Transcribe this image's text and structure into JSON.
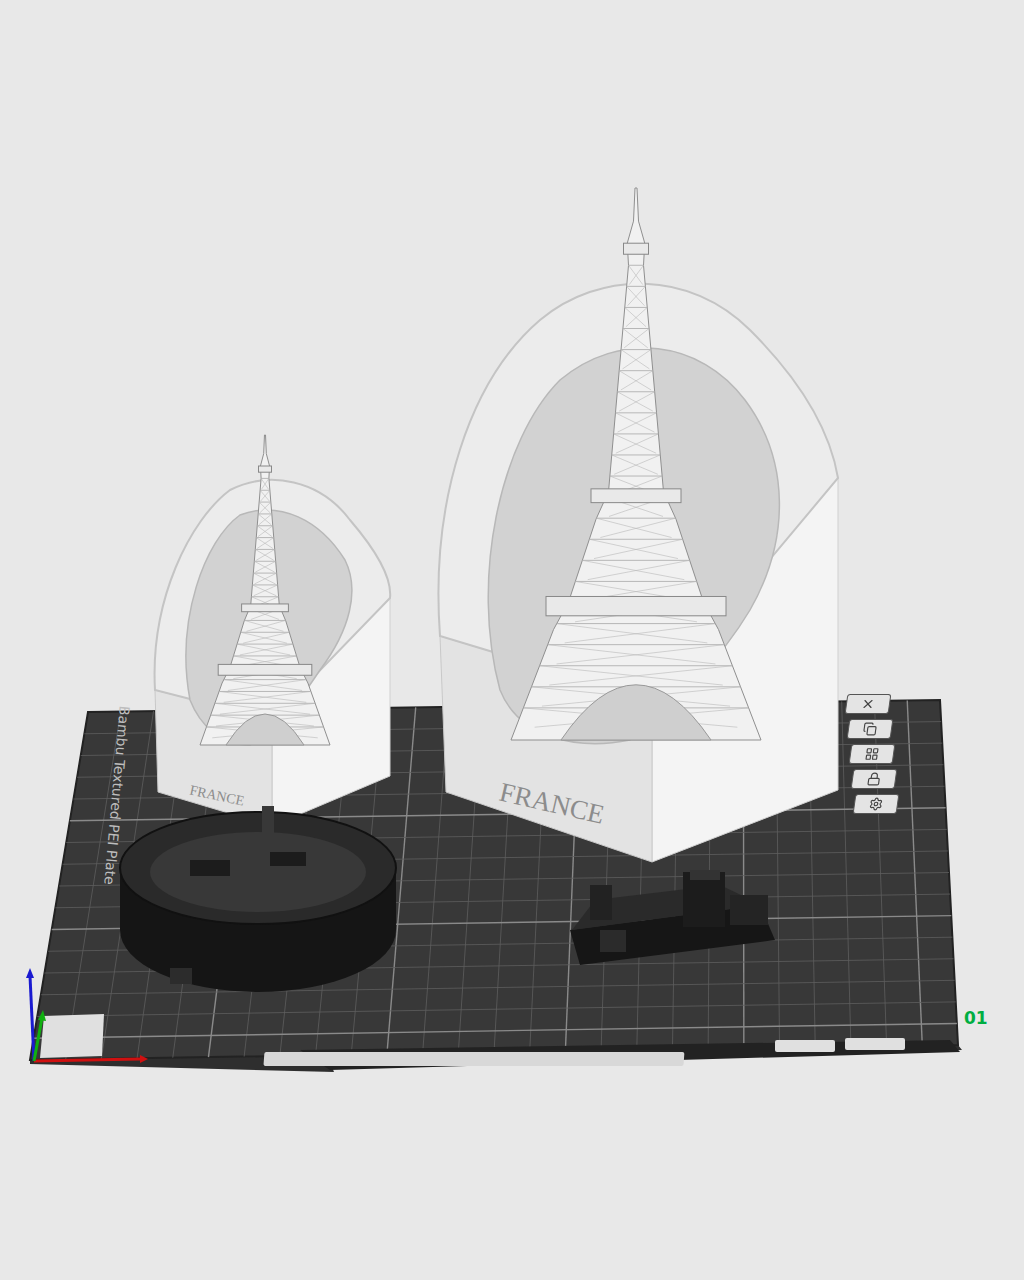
{
  "viewport": {
    "plate": {
      "label": "Bambu Textured PEI Plate",
      "number": "01"
    },
    "models": [
      {
        "engraving": "FRANCE"
      },
      {
        "engraving": "FRANCE"
      }
    ]
  }
}
